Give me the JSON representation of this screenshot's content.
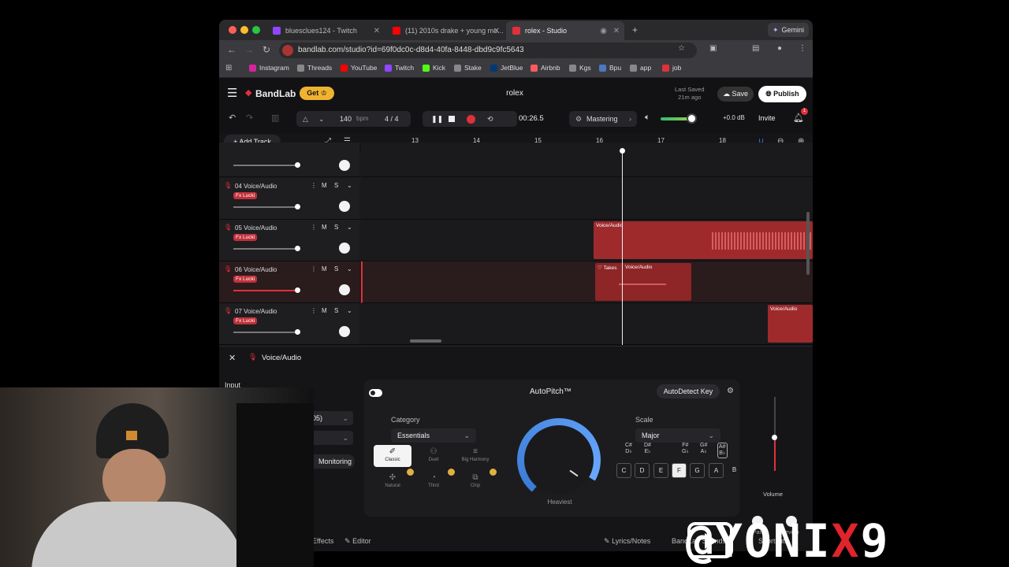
{
  "browser": {
    "tabs": [
      {
        "label": "bluesclues124 - Twitch",
        "color": "#9146ff"
      },
      {
        "label": "(11) 2010s drake + young mo...",
        "color": "#ff0000"
      },
      {
        "label": "rolex - Studio",
        "color": "#e0303a"
      }
    ],
    "gemini_label": "Gemini",
    "url": "bandlab.com/studio?id=69f0dc0c-d8d4-40fa-8448-dbd9c9fc5643",
    "bookmarks": [
      {
        "label": "Instagram",
        "color": "#d6249f"
      },
      {
        "label": "Threads",
        "color": "#888888"
      },
      {
        "label": "YouTube",
        "color": "#ff0000"
      },
      {
        "label": "Twitch",
        "color": "#9146ff"
      },
      {
        "label": "Kick",
        "color": "#53fc18"
      },
      {
        "label": "Stake",
        "color": "#888888"
      },
      {
        "label": "JetBlue",
        "color": "#003876"
      },
      {
        "label": "Airbnb",
        "color": "#ff5a5f"
      },
      {
        "label": "Kgs",
        "color": "#888888"
      },
      {
        "label": "Bpu",
        "color": "#4a78c2"
      },
      {
        "label": "app",
        "color": "#888888"
      },
      {
        "label": "job",
        "color": "#e0303a"
      }
    ]
  },
  "app": {
    "logo": "BandLab",
    "get_label": "Get",
    "project_title": "rolex",
    "last_saved_label": "Last Saved",
    "last_saved_value": "21m ago",
    "save_label": "Save",
    "publish_label": "Publish"
  },
  "transport": {
    "bpm": "140",
    "bpm_unit": "bpm",
    "time_sig": "4 / 4",
    "time": "00:26.5",
    "mastering": "Mastering",
    "volume_db": "+0.0 dB",
    "invite": "Invite",
    "notif_count": "1"
  },
  "timeline": {
    "add_track": "Add Track",
    "ruler": [
      "13",
      "14",
      "15",
      "16",
      "17",
      "18"
    ]
  },
  "tracks": [
    {
      "name": "04 Voice/Audio",
      "fx": "Fx Lucki"
    },
    {
      "name": "05 Voice/Audio",
      "fx": "Fx Lucki"
    },
    {
      "name": "06 Voice/Audio",
      "fx": "Fx Lucki"
    },
    {
      "name": "07 Voice/Audio",
      "fx": "Fx Lucki"
    }
  ],
  "clips": {
    "c05": "Voice/Audio",
    "c06_takes": "Takes",
    "c06": "Voice/Audio",
    "c07": "Voice/Audio"
  },
  "panel": {
    "title": "Voice/Audio",
    "input_label": "Input",
    "input_value_partial": "05)",
    "monitoring": "Monitoring",
    "autopitch_title": "AutoPitch™",
    "autodetect": "AutoDetect Key",
    "category_label": "Category",
    "category_value": "Essentials",
    "presets": [
      "Classic",
      "Duet",
      "Big Harmony",
      "Natural",
      "Third",
      "Chip"
    ],
    "knob_label": "Heaviest",
    "scale_label": "Scale",
    "scale_value": "Major",
    "sharps": [
      "C#\nD♭",
      "D#\nE♭",
      "F#\nG♭",
      "G#\nA♭",
      "A#\nB♭"
    ],
    "keys": [
      "C",
      "D",
      "E",
      "F",
      "G",
      "A",
      "B"
    ],
    "volume_label": "Volume",
    "pan_label": "Pan",
    "reverb_label": "Reverb",
    "bottom": {
      "effects": "Effects",
      "editor": "Editor",
      "lyrics": "Lyrics/Notes",
      "bandlab_sounds": "BandLab Sounds",
      "shortcuts": "Shortcuts"
    }
  },
  "watermark": {
    "part1": "@YONI",
    "part2": "X",
    "part3": "9"
  }
}
